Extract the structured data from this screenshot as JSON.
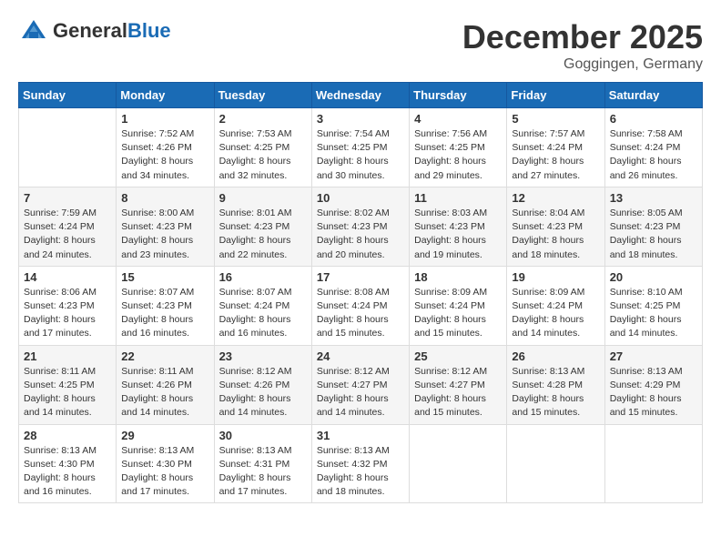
{
  "header": {
    "logo": {
      "general": "General",
      "blue": "Blue",
      "tagline": ""
    },
    "title": "December 2025",
    "subtitle": "Goggingen, Germany"
  },
  "calendar": {
    "weekdays": [
      "Sunday",
      "Monday",
      "Tuesday",
      "Wednesday",
      "Thursday",
      "Friday",
      "Saturday"
    ],
    "weeks": [
      [
        {
          "day": "",
          "info": ""
        },
        {
          "day": "1",
          "info": "Sunrise: 7:52 AM\nSunset: 4:26 PM\nDaylight: 8 hours\nand 34 minutes."
        },
        {
          "day": "2",
          "info": "Sunrise: 7:53 AM\nSunset: 4:25 PM\nDaylight: 8 hours\nand 32 minutes."
        },
        {
          "day": "3",
          "info": "Sunrise: 7:54 AM\nSunset: 4:25 PM\nDaylight: 8 hours\nand 30 minutes."
        },
        {
          "day": "4",
          "info": "Sunrise: 7:56 AM\nSunset: 4:25 PM\nDaylight: 8 hours\nand 29 minutes."
        },
        {
          "day": "5",
          "info": "Sunrise: 7:57 AM\nSunset: 4:24 PM\nDaylight: 8 hours\nand 27 minutes."
        },
        {
          "day": "6",
          "info": "Sunrise: 7:58 AM\nSunset: 4:24 PM\nDaylight: 8 hours\nand 26 minutes."
        }
      ],
      [
        {
          "day": "7",
          "info": "Sunrise: 7:59 AM\nSunset: 4:24 PM\nDaylight: 8 hours\nand 24 minutes."
        },
        {
          "day": "8",
          "info": "Sunrise: 8:00 AM\nSunset: 4:23 PM\nDaylight: 8 hours\nand 23 minutes."
        },
        {
          "day": "9",
          "info": "Sunrise: 8:01 AM\nSunset: 4:23 PM\nDaylight: 8 hours\nand 22 minutes."
        },
        {
          "day": "10",
          "info": "Sunrise: 8:02 AM\nSunset: 4:23 PM\nDaylight: 8 hours\nand 20 minutes."
        },
        {
          "day": "11",
          "info": "Sunrise: 8:03 AM\nSunset: 4:23 PM\nDaylight: 8 hours\nand 19 minutes."
        },
        {
          "day": "12",
          "info": "Sunrise: 8:04 AM\nSunset: 4:23 PM\nDaylight: 8 hours\nand 18 minutes."
        },
        {
          "day": "13",
          "info": "Sunrise: 8:05 AM\nSunset: 4:23 PM\nDaylight: 8 hours\nand 18 minutes."
        }
      ],
      [
        {
          "day": "14",
          "info": "Sunrise: 8:06 AM\nSunset: 4:23 PM\nDaylight: 8 hours\nand 17 minutes."
        },
        {
          "day": "15",
          "info": "Sunrise: 8:07 AM\nSunset: 4:23 PM\nDaylight: 8 hours\nand 16 minutes."
        },
        {
          "day": "16",
          "info": "Sunrise: 8:07 AM\nSunset: 4:24 PM\nDaylight: 8 hours\nand 16 minutes."
        },
        {
          "day": "17",
          "info": "Sunrise: 8:08 AM\nSunset: 4:24 PM\nDaylight: 8 hours\nand 15 minutes."
        },
        {
          "day": "18",
          "info": "Sunrise: 8:09 AM\nSunset: 4:24 PM\nDaylight: 8 hours\nand 15 minutes."
        },
        {
          "day": "19",
          "info": "Sunrise: 8:09 AM\nSunset: 4:24 PM\nDaylight: 8 hours\nand 14 minutes."
        },
        {
          "day": "20",
          "info": "Sunrise: 8:10 AM\nSunset: 4:25 PM\nDaylight: 8 hours\nand 14 minutes."
        }
      ],
      [
        {
          "day": "21",
          "info": "Sunrise: 8:11 AM\nSunset: 4:25 PM\nDaylight: 8 hours\nand 14 minutes."
        },
        {
          "day": "22",
          "info": "Sunrise: 8:11 AM\nSunset: 4:26 PM\nDaylight: 8 hours\nand 14 minutes."
        },
        {
          "day": "23",
          "info": "Sunrise: 8:12 AM\nSunset: 4:26 PM\nDaylight: 8 hours\nand 14 minutes."
        },
        {
          "day": "24",
          "info": "Sunrise: 8:12 AM\nSunset: 4:27 PM\nDaylight: 8 hours\nand 14 minutes."
        },
        {
          "day": "25",
          "info": "Sunrise: 8:12 AM\nSunset: 4:27 PM\nDaylight: 8 hours\nand 15 minutes."
        },
        {
          "day": "26",
          "info": "Sunrise: 8:13 AM\nSunset: 4:28 PM\nDaylight: 8 hours\nand 15 minutes."
        },
        {
          "day": "27",
          "info": "Sunrise: 8:13 AM\nSunset: 4:29 PM\nDaylight: 8 hours\nand 15 minutes."
        }
      ],
      [
        {
          "day": "28",
          "info": "Sunrise: 8:13 AM\nSunset: 4:30 PM\nDaylight: 8 hours\nand 16 minutes."
        },
        {
          "day": "29",
          "info": "Sunrise: 8:13 AM\nSunset: 4:30 PM\nDaylight: 8 hours\nand 17 minutes."
        },
        {
          "day": "30",
          "info": "Sunrise: 8:13 AM\nSunset: 4:31 PM\nDaylight: 8 hours\nand 17 minutes."
        },
        {
          "day": "31",
          "info": "Sunrise: 8:13 AM\nSunset: 4:32 PM\nDaylight: 8 hours\nand 18 minutes."
        },
        {
          "day": "",
          "info": ""
        },
        {
          "day": "",
          "info": ""
        },
        {
          "day": "",
          "info": ""
        }
      ]
    ]
  }
}
